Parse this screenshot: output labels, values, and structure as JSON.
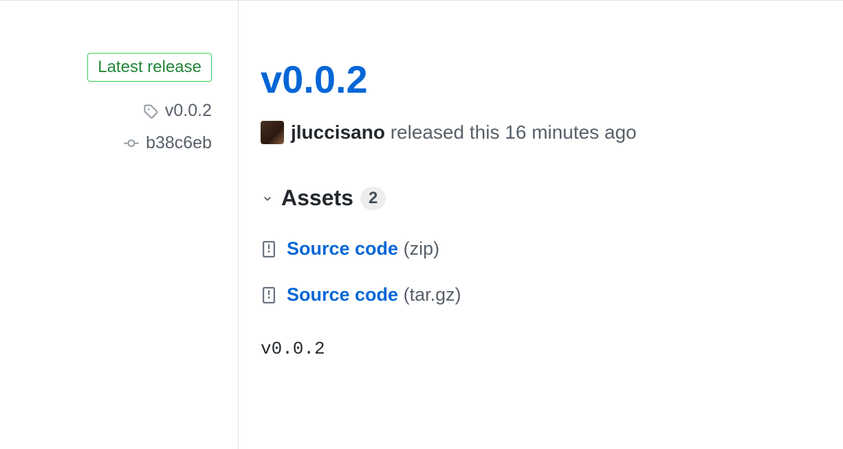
{
  "sidebar": {
    "latest_label": "Latest release",
    "tag": "v0.0.2",
    "commit": "b38c6eb"
  },
  "release": {
    "title": "v0.0.2",
    "author": "jluccisano",
    "released_text": "released this",
    "time_ago": "16 minutes ago",
    "assets_label": "Assets",
    "assets_count": "2",
    "assets": [
      {
        "name": "Source code",
        "ext": "(zip)"
      },
      {
        "name": "Source code",
        "ext": "(tar.gz)"
      }
    ],
    "body": "v0.0.2"
  }
}
